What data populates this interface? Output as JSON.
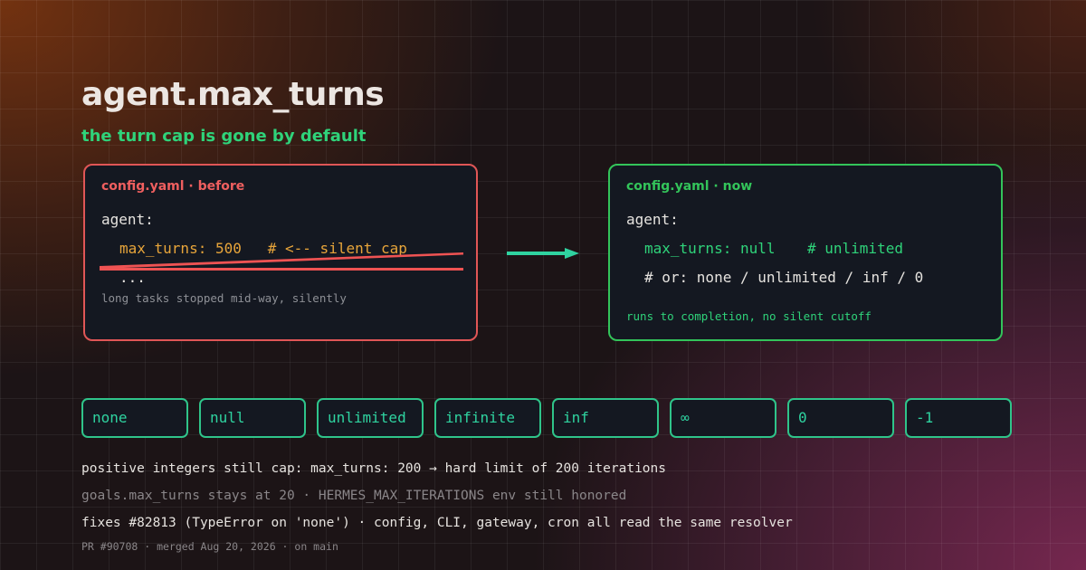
{
  "title": "agent.max_turns",
  "subtitle": "the turn cap is gone by default",
  "before": {
    "header": "config.yaml · before",
    "line1": "agent:",
    "line2": "max_turns: 500   # <-- silent cap",
    "line3": "...",
    "note": "long tasks stopped mid-way, silently",
    "accent": "#e05656"
  },
  "now": {
    "header": "config.yaml · now",
    "line1": "agent:",
    "line2_key": "max_turns: null",
    "line2_comment": "# unlimited",
    "line3": "# or: none / unlimited / inf / 0",
    "note": "runs to completion, no silent cutoff",
    "accent": "#33c45a"
  },
  "chips": [
    "none",
    "null",
    "unlimited",
    "infinite",
    "inf",
    "∞",
    "0",
    "-1"
  ],
  "footer": {
    "line1": "positive integers still cap: max_turns: 200 → hard limit of 200 iterations",
    "line2": "goals.max_turns stays at 20 · HERMES_MAX_ITERATIONS env still honored",
    "line3": "fixes #82813 (TypeError on 'none') · config, CLI, gateway, cron all read the same resolver",
    "line4": "PR #90708 · merged Aug 20, 2026 · on main"
  },
  "colors": {
    "green_accent": "#2fd37a",
    "chip_border": "#2fc48a",
    "amber": "#e8a53a",
    "panel_bg": "#141821"
  }
}
